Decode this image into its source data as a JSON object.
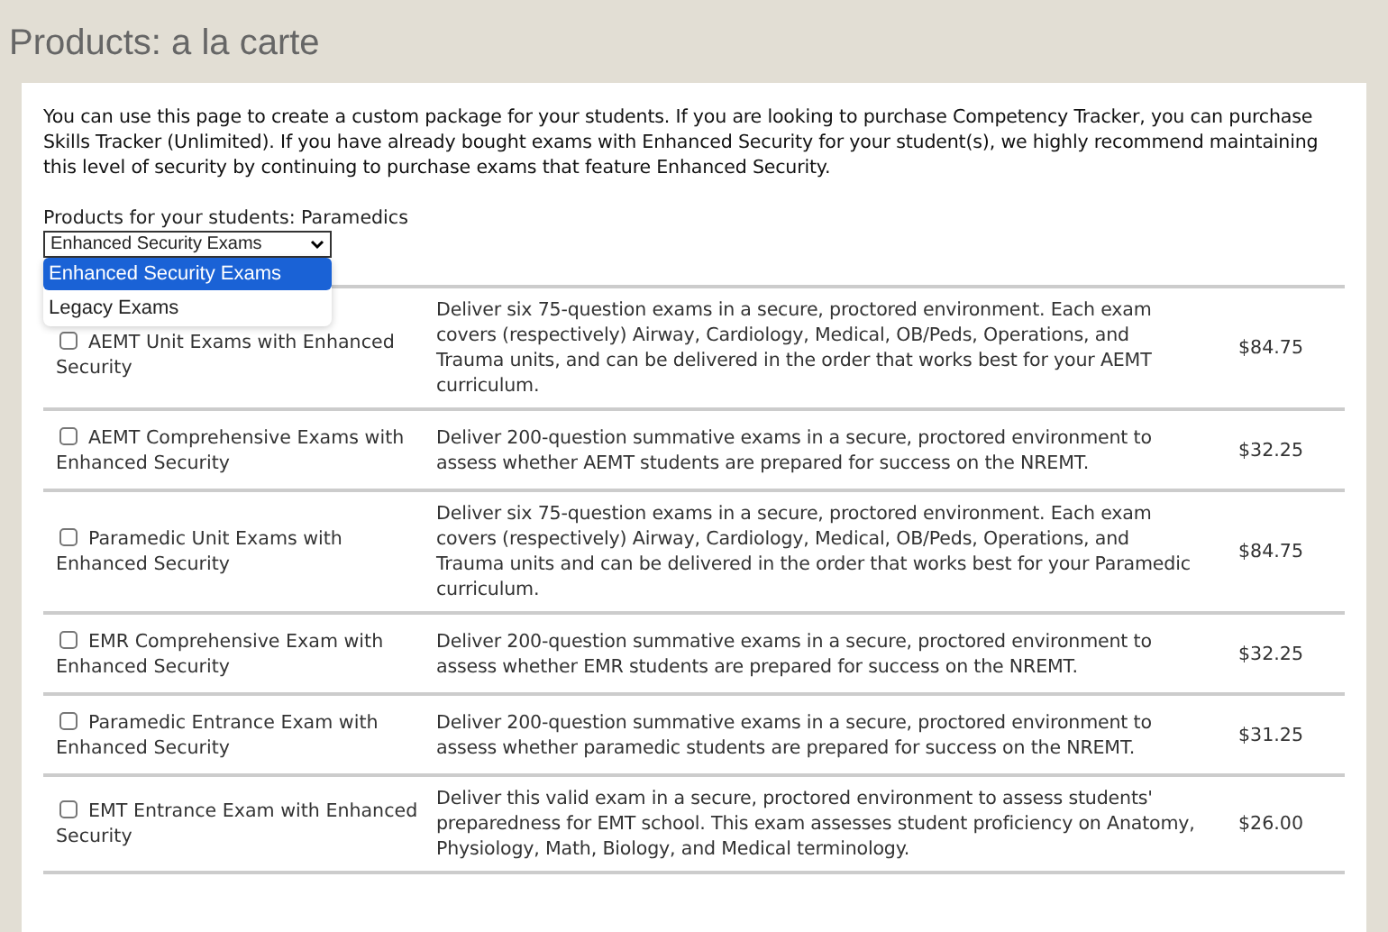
{
  "page_title": "Products: a la carte",
  "intro": "You can use this page to create a custom package for your students. If you are looking to purchase Competency Tracker, you can purchase Skills Tracker (Unlimited). If you have already bought exams with Enhanced Security for your student(s), we highly recommend maintaining this level of security by continuing to purchase exams that feature Enhanced Security.",
  "products_label": "Products for your students: Paramedics",
  "exam_select": {
    "value": "Enhanced Security Exams",
    "expanded": true,
    "options": [
      {
        "label": "Enhanced Security Exams",
        "selected": true
      },
      {
        "label": "Legacy Exams",
        "selected": false
      }
    ]
  },
  "products": [
    {
      "name": "AEMT Unit Exams with Enhanced Security",
      "checked": false,
      "description": "Deliver six 75-question exams in a secure, proctored environment. Each exam covers (respectively) Airway, Cardiology, Medical, OB/Peds, Operations, and Trauma units, and can be delivered in the order that works best for your AEMT curriculum.",
      "price": "$84.75"
    },
    {
      "name": "AEMT Comprehensive Exams with Enhanced Security",
      "checked": false,
      "description": "Deliver 200-question summative exams in a secure, proctored environment to assess whether AEMT students are prepared for success on the NREMT.",
      "price": "$32.25"
    },
    {
      "name": "Paramedic Unit Exams with Enhanced Security",
      "checked": false,
      "description": "Deliver six 75-question exams in a secure, proctored environment. Each exam covers (respectively) Airway, Cardiology, Medical, OB/Peds, Operations, and Trauma units and can be delivered in the order that works best for your Paramedic curriculum.",
      "price": "$84.75"
    },
    {
      "name": "EMR Comprehensive Exam with Enhanced Security",
      "checked": false,
      "description": "Deliver 200-question summative exams in a secure, proctored environment to assess whether EMR students are prepared for success on the NREMT.",
      "price": "$32.25"
    },
    {
      "name": "Paramedic Entrance Exam with Enhanced Security",
      "checked": false,
      "description": "Deliver 200-question summative exams in a secure, proctored environment to assess whether paramedic students are prepared for success on the NREMT.",
      "price": "$31.25"
    },
    {
      "name": "EMT Entrance Exam with Enhanced Security",
      "checked": false,
      "description": "Deliver this valid exam in a secure, proctored environment to assess students' preparedness for EMT school. This exam assesses student proficiency on Anatomy, Physiology, Math, Biology, and Medical terminology.",
      "price": "$26.00"
    }
  ]
}
